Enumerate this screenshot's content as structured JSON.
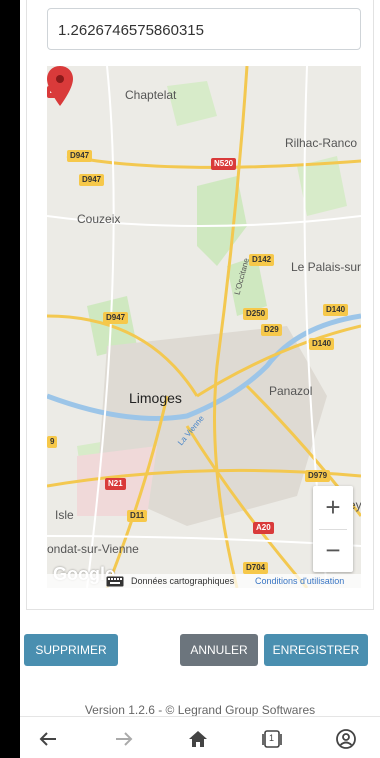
{
  "coordinate": {
    "value": "1.2626746575860315"
  },
  "map": {
    "places": [
      {
        "id": "chaptelat",
        "name": "Chaptelat"
      },
      {
        "id": "rilhac",
        "name": "Rilhac-Ranco"
      },
      {
        "id": "couzeix",
        "name": "Couzeix"
      },
      {
        "id": "palais",
        "name": "Le Palais-sur"
      },
      {
        "id": "limoges",
        "name": "Limoges"
      },
      {
        "id": "panazol",
        "name": "Panazol"
      },
      {
        "id": "isle",
        "name": "Isle"
      },
      {
        "id": "condat",
        "name": "ondat-sur-Vienne"
      },
      {
        "id": "eyjeaux",
        "name": "ey"
      }
    ],
    "river_labels": [
      "L'Occitane",
      "La Vienne"
    ],
    "roads": [
      "47",
      "D947",
      "D947",
      "N520",
      "D142",
      "D250",
      "D29",
      "D140",
      "D140",
      "D947",
      "9",
      "N21",
      "D11",
      "D979",
      "A20",
      "D704"
    ],
    "zoom_in": "+",
    "zoom_out": "−",
    "google": "Google",
    "attribution": "Données cartographiques",
    "terms": "Conditions d'utilisation",
    "pin_color": "#d93a3a"
  },
  "actions": {
    "delete": "SUPPRIMER",
    "cancel": "ANNULER",
    "save": "ENREGISTRER"
  },
  "footer": {
    "version": "Version 1.2.6 - © Legrand Group Softwares"
  },
  "navbar": {
    "items": [
      "back-icon",
      "forward-icon",
      "home-icon",
      "tabs-icon",
      "account-icon"
    ],
    "tab_count": "1"
  },
  "colors": {
    "primary_button": "#4a8fb0",
    "secondary_button": "#6c757d"
  }
}
